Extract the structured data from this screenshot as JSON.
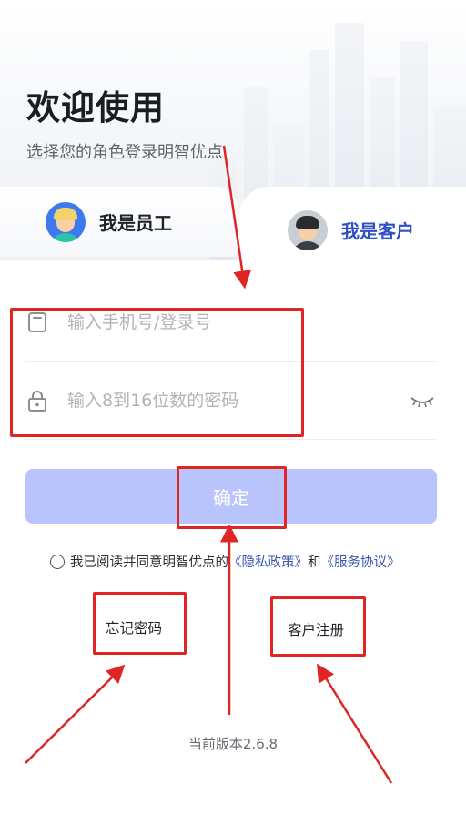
{
  "welcome": {
    "title": "欢迎使用",
    "subtitle": "选择您的角色登录明智优点"
  },
  "roles": [
    {
      "label": "我是员工",
      "icon": "employee-avatar-icon",
      "selected": false
    },
    {
      "label": "我是客户",
      "icon": "customer-avatar-icon",
      "selected": true
    }
  ],
  "form": {
    "phone": {
      "value": "",
      "placeholder": "输入手机号/登录号",
      "icon": "phone-icon"
    },
    "password": {
      "value": "",
      "placeholder": "输入8到16位数的密码",
      "icon": "lock-icon",
      "toggle_icon": "eye-closed-icon"
    },
    "confirm_label": "确定"
  },
  "agreement": {
    "checked": false,
    "prefix": "我已阅读并同意明智优点的",
    "privacy_link": "《隐私政策》",
    "conjunction": "和",
    "service_link": "《服务协议》"
  },
  "links": {
    "forgot_password": "忘记密码",
    "register": "客户注册"
  },
  "version": "当前版本2.6.8",
  "colors": {
    "primary": "#2f50c6",
    "button_disabled": "#b8c4fb",
    "link": "#3a55b4",
    "annotation": "#e02525"
  }
}
